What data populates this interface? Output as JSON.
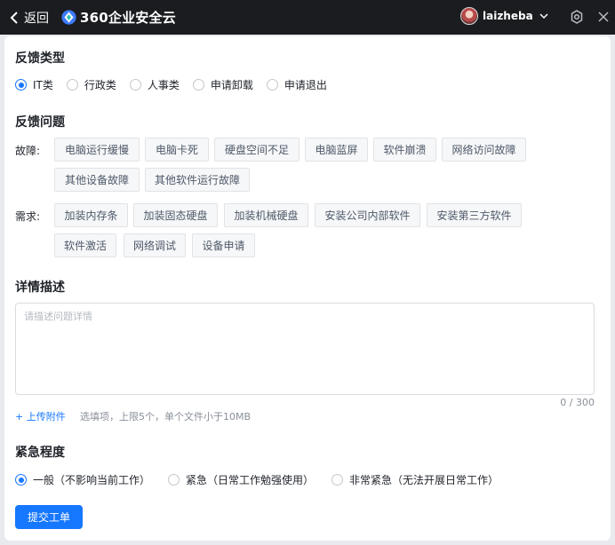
{
  "titlebar": {
    "back_label": "返回",
    "app_title": "360企业安全云",
    "username": "laizheba"
  },
  "feedback_type": {
    "title": "反馈类型",
    "options": [
      "IT类",
      "行政类",
      "人事类",
      "申请卸载",
      "申请退出"
    ],
    "selected": "IT类"
  },
  "feedback_issue": {
    "title": "反馈问题",
    "fault_label": "故障:",
    "faults": [
      "电脑运行缓慢",
      "电脑卡死",
      "硬盘空间不足",
      "电脑蓝屏",
      "软件崩溃",
      "网络访问故障",
      "其他设备故障",
      "其他软件运行故障"
    ],
    "demand_label": "需求:",
    "demands": [
      "加装内存条",
      "加装固态硬盘",
      "加装机械硬盘",
      "安装公司内部软件",
      "安装第三方软件",
      "软件激活",
      "网络调试",
      "设备申请"
    ]
  },
  "details": {
    "title": "详情描述",
    "placeholder": "请描述问题详情",
    "counter": "0 / 300",
    "upload_label": "+ 上传附件",
    "upload_hint": "选填项，上限5个，单个文件小于10MB"
  },
  "urgency": {
    "title": "紧急程度",
    "options": [
      "一般（不影响当前工作）",
      "紧急（日常工作勉强使用）",
      "非常紧急（无法开展日常工作）"
    ],
    "selected": "一般（不影响当前工作）"
  },
  "submit_label": "提交工单",
  "colors": {
    "accent": "#1677ff",
    "titlebar_bg": "#1b1c20"
  }
}
